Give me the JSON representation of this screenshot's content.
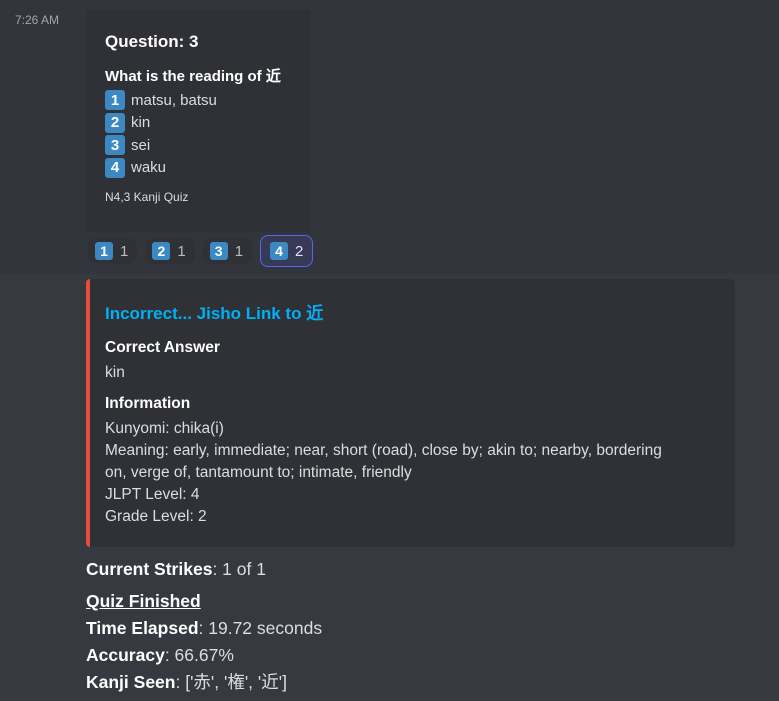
{
  "timestamp": "7:26 AM",
  "quiz_embed": {
    "title": "Question: 3",
    "question": "What is the reading of 近",
    "options": [
      {
        "num": "1",
        "text": "matsu, batsu"
      },
      {
        "num": "2",
        "text": "kin"
      },
      {
        "num": "3",
        "text": "sei"
      },
      {
        "num": "4",
        "text": "waku"
      }
    ],
    "footer": "N4,3 Kanji Quiz"
  },
  "reactions": [
    {
      "emoji": "1",
      "count": "1"
    },
    {
      "emoji": "2",
      "count": "1"
    },
    {
      "emoji": "3",
      "count": "1"
    },
    {
      "emoji": "4",
      "count": "2"
    }
  ],
  "result_embed": {
    "title": "Incorrect... Jisho Link to 近",
    "accent_color": "#e74c3c",
    "correct_label": "Correct Answer",
    "correct_value": "kin",
    "info_label": "Information",
    "info_lines": {
      "kunyomi": "Kunyomi: chika(i)",
      "meaning1": "Meaning: early, immediate; near, short (road), close by; akin to; nearby, bordering",
      "meaning2": "on, verge of, tantamount to; intimate, friendly",
      "jlpt": "JLPT Level: 4",
      "grade": "Grade Level: 2"
    }
  },
  "summary": {
    "strikes_label": "Current Strikes",
    "strikes_value": ": 1 of 1",
    "finished": "Quiz Finished",
    "time_label": "Time Elapsed",
    "time_value": ": 19.72 seconds",
    "accuracy_label": "Accuracy",
    "accuracy_value": ": 66.67%",
    "seen_label": "Kanji Seen",
    "seen_value": ": ['赤', '権', '近']"
  }
}
